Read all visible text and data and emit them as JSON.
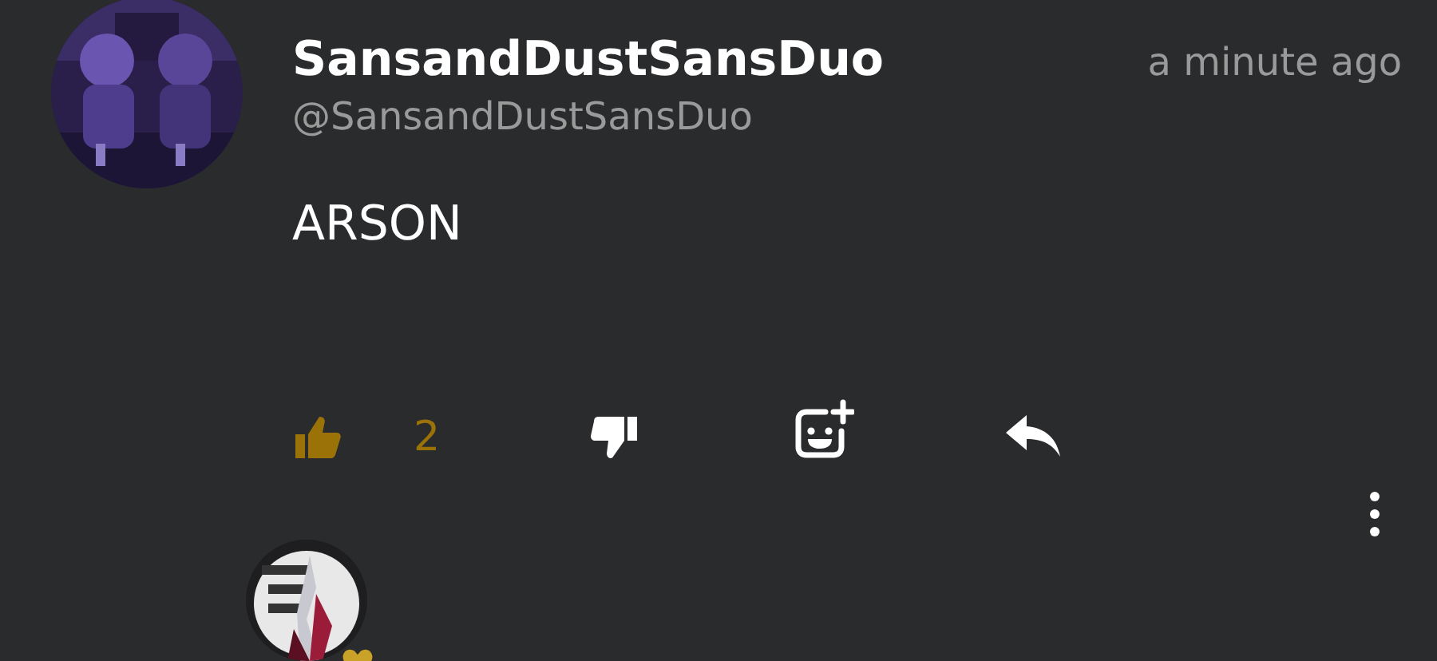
{
  "comment": {
    "author": "SansandDustSansDuo",
    "handle": "@SansandDustSansDuo",
    "time": "a minute ago",
    "text": "ARSON",
    "actions": {
      "like": {
        "count": "2",
        "selected": true
      },
      "dislike": {
        "selected": false
      }
    }
  },
  "reply_preview": {
    "badge": true
  }
}
